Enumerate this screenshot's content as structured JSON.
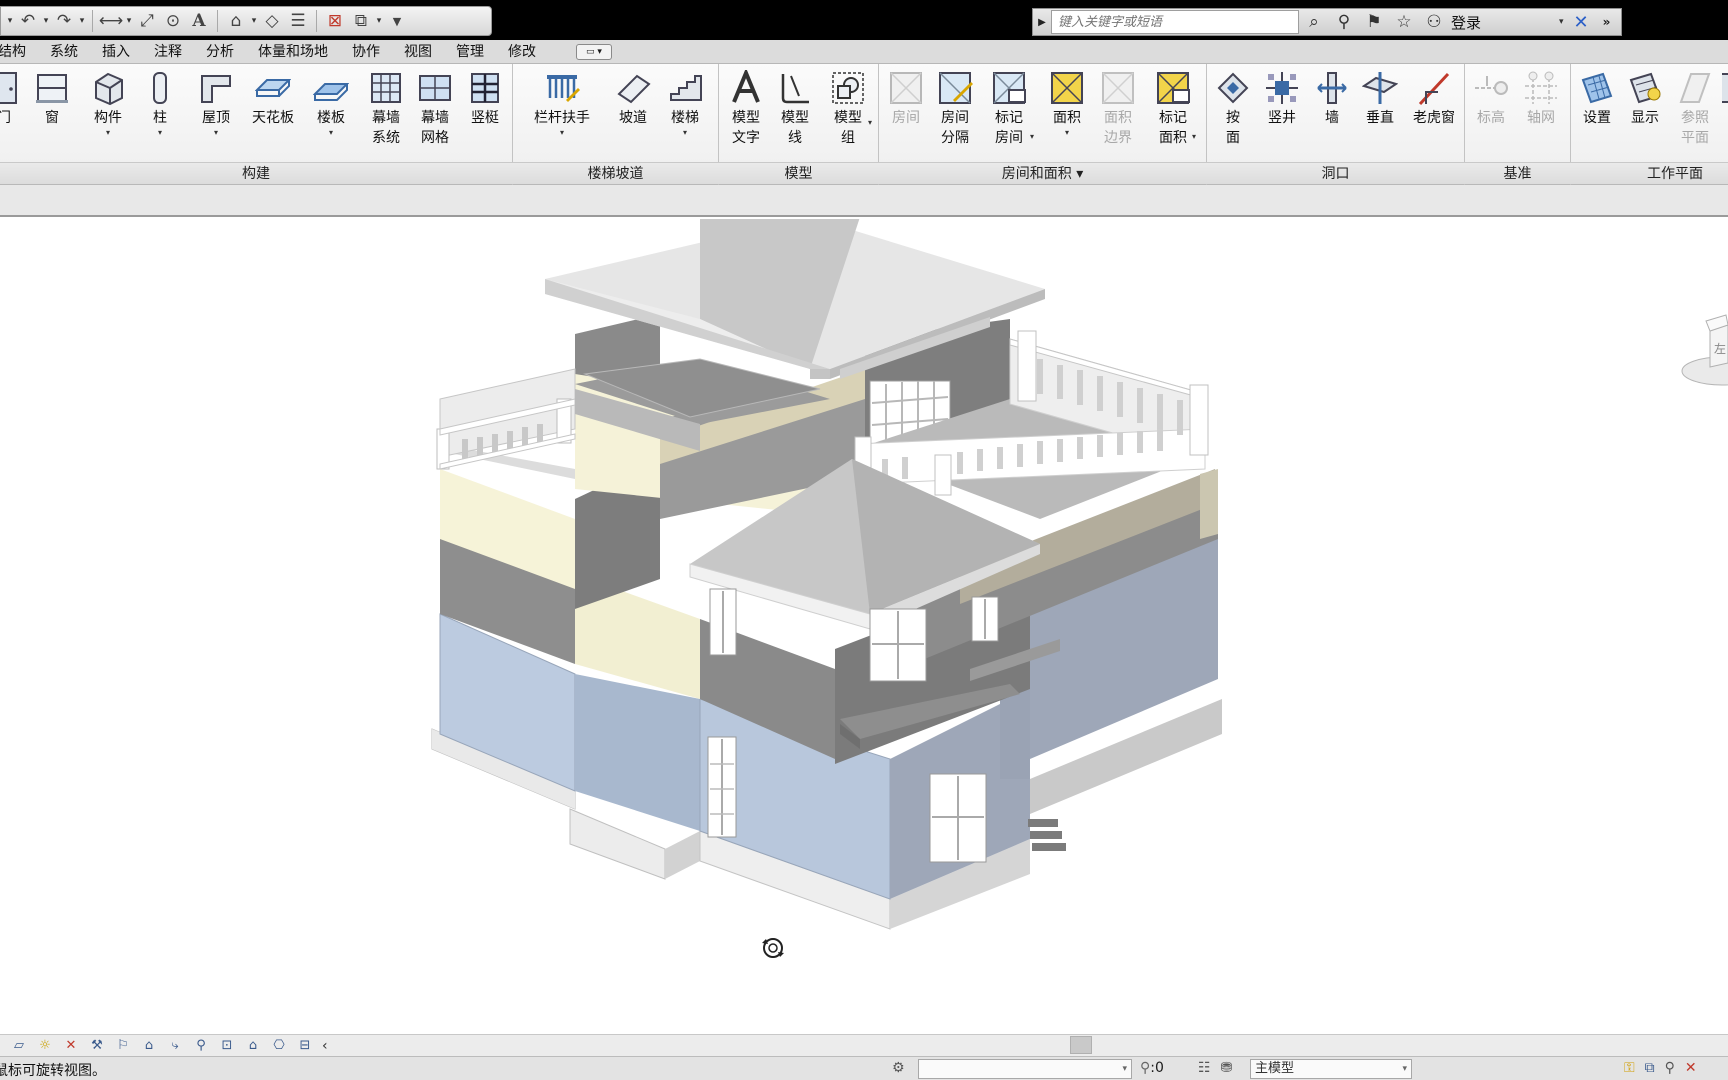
{
  "qat": {
    "icons": [
      "undo-icon",
      "redo-icon",
      "measure-icon",
      "dimension-icon",
      "tag-icon",
      "text-icon",
      "3d-view-icon",
      "section-icon",
      "thin-lines-icon",
      "close-views-icon",
      "switch-windows-icon"
    ]
  },
  "search": {
    "placeholder": "键入关键字或短语"
  },
  "header": {
    "login_label": "登录"
  },
  "tabs": [
    "结构",
    "系统",
    "插入",
    "注释",
    "分析",
    "体量和场地",
    "协作",
    "视图",
    "管理",
    "修改"
  ],
  "ribbon": {
    "buttons": [
      {
        "label": "门",
        "icon": "door-icon"
      },
      {
        "label": "窗",
        "icon": "window-icon"
      },
      {
        "label": "构件",
        "icon": "component-icon"
      },
      {
        "label": "柱",
        "icon": "column-icon"
      },
      {
        "label": "屋顶",
        "icon": "roof-icon"
      },
      {
        "label": "天花板",
        "icon": "ceiling-icon"
      },
      {
        "label": "楼板",
        "icon": "floor-icon"
      },
      {
        "label": "幕墙",
        "label2": "系统",
        "icon": "curtain-system-icon"
      },
      {
        "label": "幕墙",
        "label2": "网格",
        "icon": "curtain-grid-icon"
      },
      {
        "label": "竖梃",
        "icon": "mullion-icon"
      },
      {
        "label": "栏杆扶手",
        "icon": "railing-icon"
      },
      {
        "label": "坡道",
        "icon": "ramp-icon"
      },
      {
        "label": "楼梯",
        "icon": "stair-icon"
      },
      {
        "label": "模型",
        "label2": "文字",
        "icon": "model-text-icon"
      },
      {
        "label": "模型",
        "label2": "线",
        "icon": "model-line-icon"
      },
      {
        "label": "模型",
        "label2": "组",
        "icon": "model-group-icon"
      },
      {
        "label": "房间",
        "icon": "room-icon"
      },
      {
        "label": "房间",
        "label2": "分隔",
        "icon": "room-separator-icon"
      },
      {
        "label": "标记",
        "label2": "房间",
        "icon": "tag-room-icon"
      },
      {
        "label": "面积",
        "icon": "area-icon"
      },
      {
        "label": "面积",
        "label2": "边界",
        "icon": "area-boundary-icon"
      },
      {
        "label": "标记",
        "label2": "面积",
        "icon": "tag-area-icon"
      },
      {
        "label": "按",
        "label2": "面",
        "icon": "by-face-icon"
      },
      {
        "label": "竖井",
        "icon": "shaft-icon"
      },
      {
        "label": "墙",
        "icon": "wall-opening-icon"
      },
      {
        "label": "垂直",
        "icon": "vertical-opening-icon"
      },
      {
        "label": "老虎窗",
        "icon": "dormer-icon"
      },
      {
        "label": "标高",
        "icon": "level-icon"
      },
      {
        "label": "轴网",
        "icon": "grid-icon"
      },
      {
        "label": "设置",
        "icon": "set-workplane-icon"
      },
      {
        "label": "显示",
        "icon": "show-workplane-icon"
      },
      {
        "label": "参照",
        "label2": "平面",
        "icon": "ref-plane-icon"
      }
    ],
    "panels": [
      "构建",
      "楼梯坡道",
      "模型",
      "房间和面积 ▾",
      "洞口",
      "基准",
      "工作平面"
    ]
  },
  "viewbar": {
    "icons": [
      "scale-icon",
      "detail-level-icon",
      "visual-style-icon",
      "sun-path-icon",
      "shadows-icon",
      "render-icon",
      "crop-icon",
      "show-crop-icon",
      "temp-hide-icon",
      "reveal-hidden-icon",
      "analytical-icon",
      "highlight-icon"
    ],
    "collapse": "‹"
  },
  "status": {
    "message": "鼠标可旋转视图。",
    "filter_count": ":0",
    "active_model": "主模型"
  },
  "colors": {
    "wall_blue": "#b8c8de",
    "wall_gray": "#8f8f8f",
    "wall_cream": "#f6f3d8",
    "roof_light": "#e3e3e3",
    "base_white": "#eeeeee"
  }
}
